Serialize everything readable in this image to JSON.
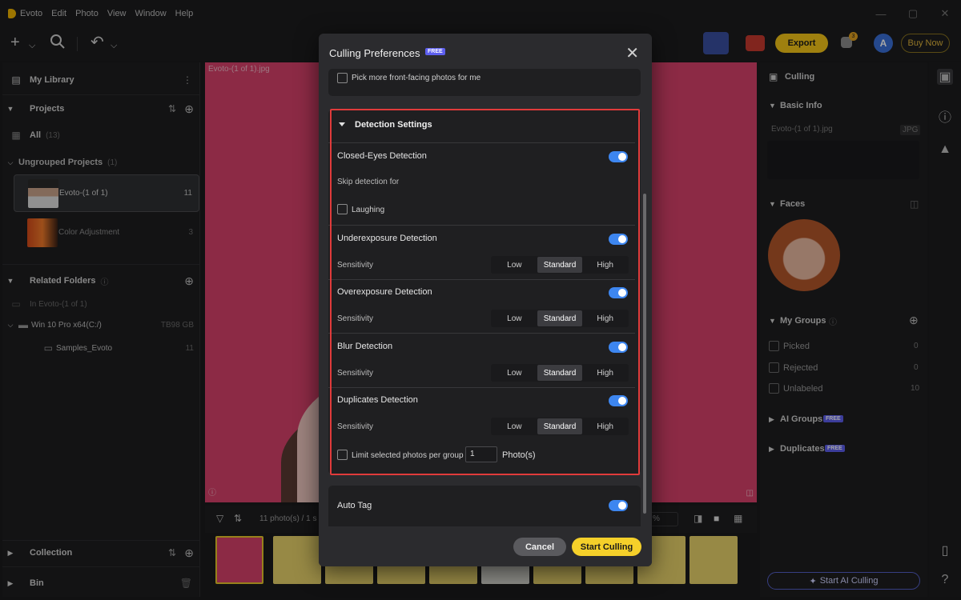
{
  "app": {
    "name": "Evoto",
    "menu": [
      "Edit",
      "Photo",
      "View",
      "Window",
      "Help"
    ]
  },
  "toolbar": {
    "export_label": "Export",
    "notification_badge": "3",
    "avatar_letter": "A",
    "buy_now_label": "Buy Now"
  },
  "left_panel": {
    "library_title": "My Library",
    "projects_title": "Projects",
    "all_label": "All",
    "all_count": "(13)",
    "ungrouped_label": "Ungrouped Projects",
    "ungrouped_count": "(1)",
    "projects": [
      {
        "name": "Evoto-(1 of 1)",
        "count": "11"
      },
      {
        "name": "Color Adjustment",
        "count": "3"
      }
    ],
    "related_folders_title": "Related Folders",
    "in_project_label": "In Evoto-(1 of 1)",
    "drive_label": "Win 10 Pro x64(C:/)",
    "drive_size": "TB98 GB",
    "folder_label": "Samples_Evoto",
    "folder_count": "11",
    "collection_title": "Collection",
    "bin_title": "Bin"
  },
  "center": {
    "photo_label": "Evoto-(1 of 1).jpg",
    "photo_count": "11 photo(s) / 1 s",
    "zoom_value": "%"
  },
  "right_panel": {
    "culling_title": "Culling",
    "basic_info_title": "Basic Info",
    "file_name": "Evoto-(1 of 1).jpg",
    "file_type": "JPG",
    "faces_title": "Faces",
    "my_groups_title": "My Groups",
    "groups": [
      {
        "label": "Picked",
        "count": "0"
      },
      {
        "label": "Rejected",
        "count": "0"
      },
      {
        "label": "Unlabeled",
        "count": "10"
      }
    ],
    "ai_groups_title": "AI Groups",
    "duplicates_title": "Duplicates",
    "free_badge": "FREE",
    "start_ai_label": "Start AI Culling"
  },
  "dialog": {
    "title": "Culling Preferences",
    "free_badge": "FREE",
    "front_facing_label": "Pick more front-facing photos for me",
    "detection_settings_title": "Detection Settings",
    "closed_eyes_label": "Closed-Eyes Detection",
    "skip_detection_label": "Skip detection for",
    "laughing_label": "Laughing",
    "underexposure_label": "Underexposure Detection",
    "overexposure_label": "Overexposure Detection",
    "blur_label": "Blur Detection",
    "duplicates_label": "Duplicates Detection",
    "sensitivity_label": "Sensitivity",
    "sensitivity_options": [
      "Low",
      "Standard",
      "High"
    ],
    "sensitivity_selected": "Standard",
    "limit_label": "Limit selected photos per group",
    "limit_value": "1",
    "limit_unit": "Photo(s)",
    "auto_tag_label": "Auto Tag",
    "cancel_label": "Cancel",
    "start_label": "Start Culling"
  },
  "colors": {
    "accent_yellow": "#f5d02a",
    "toggle_blue": "#3d86f0",
    "highlight_red": "#e03b3b",
    "photo_bg": "#d8416b"
  }
}
